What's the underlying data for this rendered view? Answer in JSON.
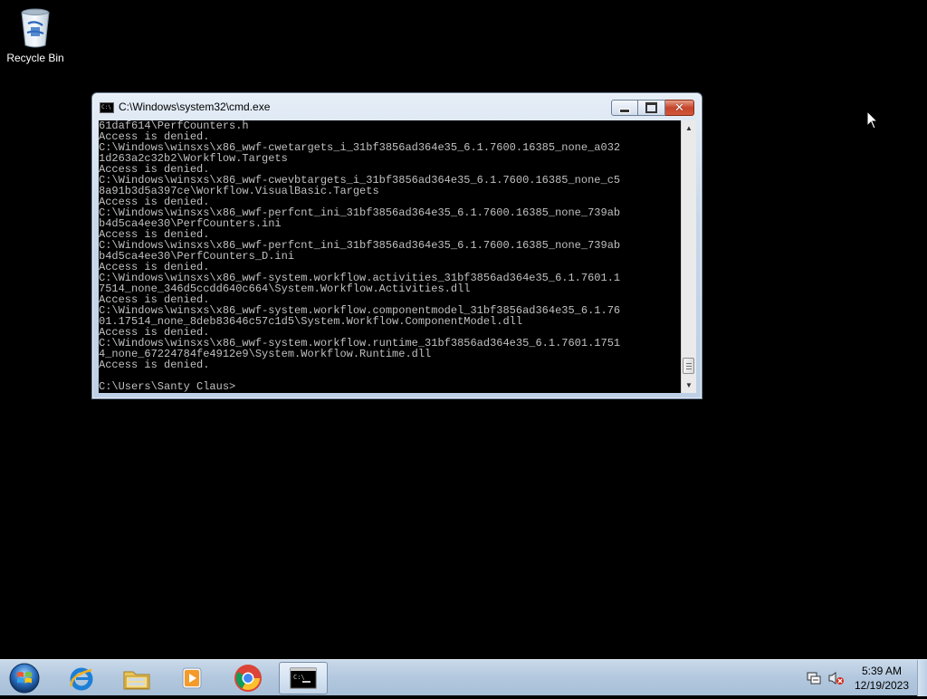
{
  "desktop": {
    "icons": [
      {
        "label": "Recycle Bin",
        "icon": "recycle-bin-icon"
      }
    ]
  },
  "cmd_window": {
    "title": "C:\\Windows\\system32\\cmd.exe",
    "buttons": {
      "minimize": "minimize",
      "maximize": "maximize",
      "close": "close"
    },
    "lines": [
      "61daf614\\PerfCounters.h",
      "Access is denied.",
      "C:\\Windows\\winsxs\\x86_wwf-cwetargets_i_31bf3856ad364e35_6.1.7600.16385_none_a032",
      "1d263a2c32b2\\Workflow.Targets",
      "Access is denied.",
      "C:\\Windows\\winsxs\\x86_wwf-cwevbtargets_i_31bf3856ad364e35_6.1.7600.16385_none_c5",
      "8a91b3d5a397ce\\Workflow.VisualBasic.Targets",
      "Access is denied.",
      "C:\\Windows\\winsxs\\x86_wwf-perfcnt_ini_31bf3856ad364e35_6.1.7600.16385_none_739ab",
      "b4d5ca4ee30\\PerfCounters.ini",
      "Access is denied.",
      "C:\\Windows\\winsxs\\x86_wwf-perfcnt_ini_31bf3856ad364e35_6.1.7600.16385_none_739ab",
      "b4d5ca4ee30\\PerfCounters_D.ini",
      "Access is denied.",
      "C:\\Windows\\winsxs\\x86_wwf-system.workflow.activities_31bf3856ad364e35_6.1.7601.1",
      "7514_none_346d5ccdd640c664\\System.Workflow.Activities.dll",
      "Access is denied.",
      "C:\\Windows\\winsxs\\x86_wwf-system.workflow.componentmodel_31bf3856ad364e35_6.1.76",
      "01.17514_none_8deb83646c57c1d5\\System.Workflow.ComponentModel.dll",
      "Access is denied.",
      "C:\\Windows\\winsxs\\x86_wwf-system.workflow.runtime_31bf3856ad364e35_6.1.7601.1751",
      "4_none_67224784fe4912e9\\System.Workflow.Runtime.dll",
      "Access is denied.",
      "",
      "C:\\Users\\Santy Claus>"
    ]
  },
  "taskbar": {
    "start": "start-orb-icon",
    "pinned": [
      {
        "name": "internet-explorer-icon",
        "active": false
      },
      {
        "name": "file-explorer-icon",
        "active": false
      },
      {
        "name": "media-player-icon",
        "active": false
      },
      {
        "name": "chrome-icon",
        "active": false
      },
      {
        "name": "cmd-icon",
        "active": true
      }
    ],
    "tray": {
      "icons": [
        "action-center-icon",
        "volume-muted-icon"
      ],
      "time": "5:39 AM",
      "date": "12/19/2023"
    }
  },
  "colors": {
    "console_bg": "#000000",
    "console_text": "#c0c0c0",
    "desktop_bg": "#000000",
    "close_button": "#c6452b"
  }
}
